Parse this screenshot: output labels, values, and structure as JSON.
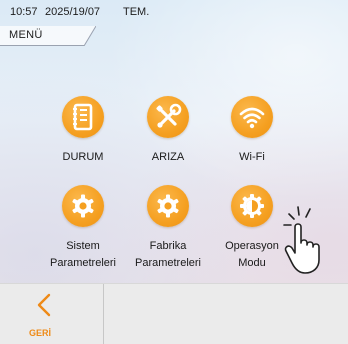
{
  "status": {
    "time": "10:57",
    "date": "2025/19/07",
    "temp_label": "TEM."
  },
  "menu": {
    "label": "MENÜ"
  },
  "tiles": [
    {
      "name": "durum",
      "icon": "notebook-icon",
      "lines": [
        "DURUM"
      ]
    },
    {
      "name": "ariza",
      "icon": "wrench-screwdriver-icon",
      "lines": [
        "ARIZA"
      ]
    },
    {
      "name": "wifi",
      "icon": "wifi-icon",
      "lines": [
        "Wi-Fi"
      ]
    },
    {
      "name": "sistem-parametreleri",
      "icon": "gear-icon",
      "lines": [
        "Sistem",
        "Parametreleri"
      ]
    },
    {
      "name": "fabrika-parametreleri",
      "icon": "gear-icon",
      "lines": [
        "Fabrika",
        "Parametreleri"
      ]
    },
    {
      "name": "operasyon-modu",
      "icon": "contrast-gear-icon",
      "lines": [
        "Operasyon",
        "Modu"
      ]
    }
  ],
  "back": {
    "label": "GERİ",
    "icon": "chevron-left-icon"
  },
  "colors": {
    "accent": "#f5a021",
    "back_text": "#ee8a17"
  }
}
